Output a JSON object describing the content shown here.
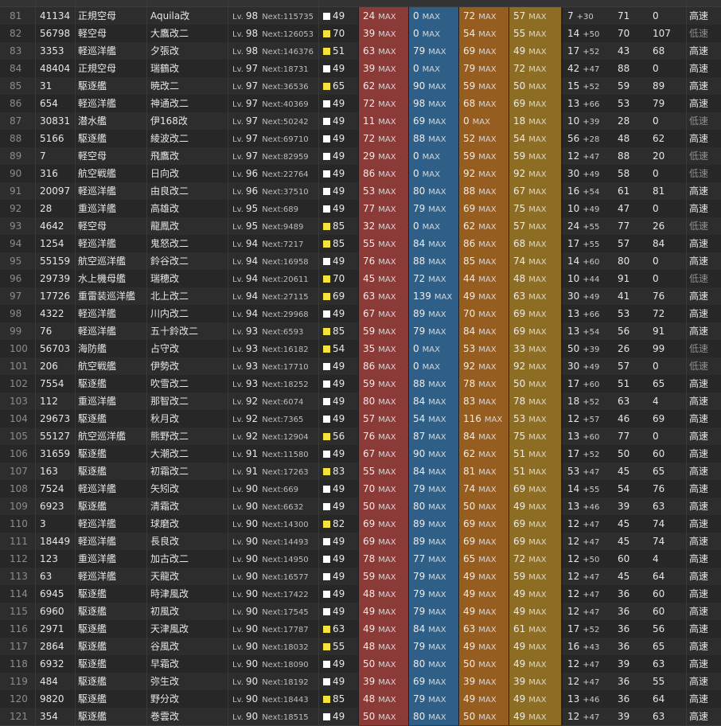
{
  "columns": [
    "no",
    "id",
    "type",
    "name",
    "lv",
    "next",
    "cond",
    "fp",
    "tp",
    "aa",
    "ar",
    "luck",
    "luck_plus",
    "hp",
    "asw",
    "speed"
  ],
  "max_label": "MAX",
  "lv_prefix": "Lv.",
  "next_prefix": "Next:",
  "colors": {
    "cond_white": "#ffffff",
    "cond_yellow": "#f4e33a",
    "fp": "#8a3a37",
    "tp": "#2f5f86",
    "aa": "#955d20",
    "ar": "#8d6d23"
  },
  "rows": [
    {
      "no": "81",
      "id": "41134",
      "type": "正規空母",
      "name": "Aquila改",
      "lv": "98",
      "next": "115735",
      "cond_color": "white",
      "cond": "49",
      "fp": "24",
      "tp": "0",
      "aa": "72",
      "ar": "57",
      "luck": "7",
      "luck_plus": "+30",
      "hp": "71",
      "asw": "0",
      "speed": "高速"
    },
    {
      "no": "82",
      "id": "56798",
      "type": "軽空母",
      "name": "大鷹改二",
      "lv": "98",
      "next": "126053",
      "cond_color": "yellow",
      "cond": "70",
      "fp": "39",
      "tp": "0",
      "aa": "54",
      "ar": "55",
      "luck": "14",
      "luck_plus": "+50",
      "hp": "70",
      "asw": "107",
      "speed": "低速"
    },
    {
      "no": "83",
      "id": "3353",
      "type": "軽巡洋艦",
      "name": "夕張改",
      "lv": "98",
      "next": "146376",
      "cond_color": "yellow",
      "cond": "51",
      "fp": "63",
      "tp": "79",
      "aa": "69",
      "ar": "49",
      "luck": "17",
      "luck_plus": "+52",
      "hp": "43",
      "asw": "68",
      "speed": "高速"
    },
    {
      "no": "84",
      "id": "48404",
      "type": "正規空母",
      "name": "瑞鶴改",
      "lv": "97",
      "next": "18731",
      "cond_color": "white",
      "cond": "49",
      "fp": "39",
      "tp": "0",
      "aa": "79",
      "ar": "72",
      "luck": "42",
      "luck_plus": "+47",
      "hp": "88",
      "asw": "0",
      "speed": "高速"
    },
    {
      "no": "85",
      "id": "31",
      "type": "駆逐艦",
      "name": "暁改二",
      "lv": "97",
      "next": "36536",
      "cond_color": "yellow",
      "cond": "65",
      "fp": "62",
      "tp": "90",
      "aa": "59",
      "ar": "50",
      "luck": "15",
      "luck_plus": "+52",
      "hp": "59",
      "asw": "89",
      "speed": "高速"
    },
    {
      "no": "86",
      "id": "654",
      "type": "軽巡洋艦",
      "name": "神通改二",
      "lv": "97",
      "next": "40369",
      "cond_color": "white",
      "cond": "49",
      "fp": "72",
      "tp": "98",
      "aa": "68",
      "ar": "69",
      "luck": "13",
      "luck_plus": "+66",
      "hp": "53",
      "asw": "79",
      "speed": "高速"
    },
    {
      "no": "87",
      "id": "30831",
      "type": "潜水艦",
      "name": "伊168改",
      "lv": "97",
      "next": "50242",
      "cond_color": "white",
      "cond": "49",
      "fp": "11",
      "tp": "69",
      "aa": "0",
      "ar": "18",
      "luck": "10",
      "luck_plus": "+39",
      "hp": "28",
      "asw": "0",
      "speed": "低速"
    },
    {
      "no": "88",
      "id": "5166",
      "type": "駆逐艦",
      "name": "綾波改二",
      "lv": "97",
      "next": "69710",
      "cond_color": "white",
      "cond": "49",
      "fp": "72",
      "tp": "88",
      "aa": "52",
      "ar": "54",
      "luck": "56",
      "luck_plus": "+28",
      "hp": "48",
      "asw": "62",
      "speed": "高速"
    },
    {
      "no": "89",
      "id": "7",
      "type": "軽空母",
      "name": "飛鷹改",
      "lv": "97",
      "next": "82959",
      "cond_color": "white",
      "cond": "49",
      "fp": "29",
      "tp": "0",
      "aa": "59",
      "ar": "59",
      "luck": "12",
      "luck_plus": "+47",
      "hp": "88",
      "asw": "20",
      "speed": "低速"
    },
    {
      "no": "90",
      "id": "316",
      "type": "航空戦艦",
      "name": "日向改",
      "lv": "96",
      "next": "22764",
      "cond_color": "white",
      "cond": "49",
      "fp": "86",
      "tp": "0",
      "aa": "92",
      "ar": "92",
      "luck": "30",
      "luck_plus": "+49",
      "hp": "58",
      "asw": "0",
      "speed": "低速"
    },
    {
      "no": "91",
      "id": "20097",
      "type": "軽巡洋艦",
      "name": "由良改二",
      "lv": "96",
      "next": "37510",
      "cond_color": "white",
      "cond": "49",
      "fp": "53",
      "tp": "80",
      "aa": "88",
      "ar": "67",
      "luck": "16",
      "luck_plus": "+54",
      "hp": "61",
      "asw": "81",
      "speed": "高速"
    },
    {
      "no": "92",
      "id": "28",
      "type": "重巡洋艦",
      "name": "高雄改",
      "lv": "95",
      "next": "689",
      "cond_color": "white",
      "cond": "49",
      "fp": "77",
      "tp": "79",
      "aa": "69",
      "ar": "75",
      "luck": "10",
      "luck_plus": "+49",
      "hp": "47",
      "asw": "0",
      "speed": "高速"
    },
    {
      "no": "93",
      "id": "4642",
      "type": "軽空母",
      "name": "龍鳳改",
      "lv": "95",
      "next": "9489",
      "cond_color": "yellow",
      "cond": "85",
      "fp": "32",
      "tp": "0",
      "aa": "62",
      "ar": "57",
      "luck": "24",
      "luck_plus": "+55",
      "hp": "77",
      "asw": "26",
      "speed": "低速"
    },
    {
      "no": "94",
      "id": "1254",
      "type": "軽巡洋艦",
      "name": "鬼怒改二",
      "lv": "94",
      "next": "7217",
      "cond_color": "yellow",
      "cond": "85",
      "fp": "55",
      "tp": "84",
      "aa": "86",
      "ar": "68",
      "luck": "17",
      "luck_plus": "+55",
      "hp": "57",
      "asw": "84",
      "speed": "高速"
    },
    {
      "no": "95",
      "id": "55159",
      "type": "航空巡洋艦",
      "name": "鈴谷改二",
      "lv": "94",
      "next": "16958",
      "cond_color": "white",
      "cond": "49",
      "fp": "76",
      "tp": "88",
      "aa": "85",
      "ar": "74",
      "luck": "14",
      "luck_plus": "+60",
      "hp": "80",
      "asw": "0",
      "speed": "高速"
    },
    {
      "no": "96",
      "id": "29739",
      "type": "水上機母艦",
      "name": "瑞穂改",
      "lv": "94",
      "next": "20611",
      "cond_color": "yellow",
      "cond": "70",
      "fp": "45",
      "tp": "72",
      "aa": "44",
      "ar": "48",
      "luck": "10",
      "luck_plus": "+44",
      "hp": "91",
      "asw": "0",
      "speed": "低速"
    },
    {
      "no": "97",
      "id": "17726",
      "type": "重雷装巡洋艦",
      "name": "北上改二",
      "lv": "94",
      "next": "27115",
      "cond_color": "yellow",
      "cond": "69",
      "fp": "63",
      "tp": "139",
      "aa": "49",
      "ar": "63",
      "luck": "30",
      "luck_plus": "+49",
      "hp": "41",
      "asw": "76",
      "speed": "高速"
    },
    {
      "no": "98",
      "id": "4322",
      "type": "軽巡洋艦",
      "name": "川内改二",
      "lv": "94",
      "next": "29968",
      "cond_color": "white",
      "cond": "49",
      "fp": "67",
      "tp": "89",
      "aa": "70",
      "ar": "69",
      "luck": "13",
      "luck_plus": "+66",
      "hp": "53",
      "asw": "72",
      "speed": "高速"
    },
    {
      "no": "99",
      "id": "76",
      "type": "軽巡洋艦",
      "name": "五十鈴改二",
      "lv": "93",
      "next": "6593",
      "cond_color": "yellow",
      "cond": "85",
      "fp": "59",
      "tp": "79",
      "aa": "84",
      "ar": "69",
      "luck": "13",
      "luck_plus": "+54",
      "hp": "56",
      "asw": "91",
      "speed": "高速"
    },
    {
      "no": "100",
      "id": "56703",
      "type": "海防艦",
      "name": "占守改",
      "lv": "93",
      "next": "16182",
      "cond_color": "yellow",
      "cond": "54",
      "fp": "35",
      "tp": "0",
      "aa": "53",
      "ar": "33",
      "luck": "50",
      "luck_plus": "+39",
      "hp": "26",
      "asw": "99",
      "speed": "低速"
    },
    {
      "no": "101",
      "id": "206",
      "type": "航空戦艦",
      "name": "伊勢改",
      "lv": "93",
      "next": "17710",
      "cond_color": "white",
      "cond": "49",
      "fp": "86",
      "tp": "0",
      "aa": "92",
      "ar": "92",
      "luck": "30",
      "luck_plus": "+49",
      "hp": "57",
      "asw": "0",
      "speed": "低速"
    },
    {
      "no": "102",
      "id": "7554",
      "type": "駆逐艦",
      "name": "吹雪改二",
      "lv": "93",
      "next": "18252",
      "cond_color": "white",
      "cond": "49",
      "fp": "59",
      "tp": "88",
      "aa": "78",
      "ar": "50",
      "luck": "17",
      "luck_plus": "+60",
      "hp": "51",
      "asw": "65",
      "speed": "高速"
    },
    {
      "no": "103",
      "id": "112",
      "type": "重巡洋艦",
      "name": "那智改二",
      "lv": "92",
      "next": "6074",
      "cond_color": "white",
      "cond": "49",
      "fp": "80",
      "tp": "84",
      "aa": "83",
      "ar": "78",
      "luck": "18",
      "luck_plus": "+52",
      "hp": "63",
      "asw": "4",
      "speed": "高速"
    },
    {
      "no": "104",
      "id": "29673",
      "type": "駆逐艦",
      "name": "秋月改",
      "lv": "92",
      "next": "7365",
      "cond_color": "white",
      "cond": "49",
      "fp": "57",
      "tp": "54",
      "aa": "116",
      "ar": "53",
      "luck": "12",
      "luck_plus": "+57",
      "hp": "46",
      "asw": "69",
      "speed": "高速"
    },
    {
      "no": "105",
      "id": "55127",
      "type": "航空巡洋艦",
      "name": "熊野改二",
      "lv": "92",
      "next": "12904",
      "cond_color": "yellow",
      "cond": "56",
      "fp": "76",
      "tp": "87",
      "aa": "84",
      "ar": "75",
      "luck": "13",
      "luck_plus": "+60",
      "hp": "77",
      "asw": "0",
      "speed": "高速"
    },
    {
      "no": "106",
      "id": "31659",
      "type": "駆逐艦",
      "name": "大潮改二",
      "lv": "91",
      "next": "11580",
      "cond_color": "white",
      "cond": "49",
      "fp": "67",
      "tp": "90",
      "aa": "62",
      "ar": "51",
      "luck": "17",
      "luck_plus": "+52",
      "hp": "50",
      "asw": "60",
      "speed": "高速"
    },
    {
      "no": "107",
      "id": "163",
      "type": "駆逐艦",
      "name": "初霜改二",
      "lv": "91",
      "next": "17263",
      "cond_color": "yellow",
      "cond": "83",
      "fp": "55",
      "tp": "84",
      "aa": "81",
      "ar": "51",
      "luck": "53",
      "luck_plus": "+47",
      "hp": "45",
      "asw": "65",
      "speed": "高速"
    },
    {
      "no": "108",
      "id": "7524",
      "type": "軽巡洋艦",
      "name": "矢矧改",
      "lv": "90",
      "next": "669",
      "cond_color": "white",
      "cond": "49",
      "fp": "70",
      "tp": "79",
      "aa": "74",
      "ar": "69",
      "luck": "14",
      "luck_plus": "+55",
      "hp": "54",
      "asw": "76",
      "speed": "高速"
    },
    {
      "no": "109",
      "id": "6923",
      "type": "駆逐艦",
      "name": "清霜改",
      "lv": "90",
      "next": "6632",
      "cond_color": "white",
      "cond": "49",
      "fp": "50",
      "tp": "80",
      "aa": "50",
      "ar": "49",
      "luck": "13",
      "luck_plus": "+46",
      "hp": "39",
      "asw": "63",
      "speed": "高速"
    },
    {
      "no": "110",
      "id": "3",
      "type": "軽巡洋艦",
      "name": "球磨改",
      "lv": "90",
      "next": "14300",
      "cond_color": "yellow",
      "cond": "82",
      "fp": "69",
      "tp": "89",
      "aa": "69",
      "ar": "69",
      "luck": "12",
      "luck_plus": "+47",
      "hp": "45",
      "asw": "74",
      "speed": "高速"
    },
    {
      "no": "111",
      "id": "18449",
      "type": "軽巡洋艦",
      "name": "長良改",
      "lv": "90",
      "next": "14493",
      "cond_color": "white",
      "cond": "49",
      "fp": "69",
      "tp": "89",
      "aa": "69",
      "ar": "69",
      "luck": "12",
      "luck_plus": "+47",
      "hp": "45",
      "asw": "74",
      "speed": "高速"
    },
    {
      "no": "112",
      "id": "123",
      "type": "重巡洋艦",
      "name": "加古改二",
      "lv": "90",
      "next": "14950",
      "cond_color": "white",
      "cond": "49",
      "fp": "78",
      "tp": "77",
      "aa": "65",
      "ar": "72",
      "luck": "12",
      "luck_plus": "+50",
      "hp": "60",
      "asw": "4",
      "speed": "高速"
    },
    {
      "no": "113",
      "id": "63",
      "type": "軽巡洋艦",
      "name": "天龍改",
      "lv": "90",
      "next": "16577",
      "cond_color": "white",
      "cond": "49",
      "fp": "59",
      "tp": "79",
      "aa": "49",
      "ar": "59",
      "luck": "12",
      "luck_plus": "+47",
      "hp": "45",
      "asw": "64",
      "speed": "高速"
    },
    {
      "no": "114",
      "id": "6945",
      "type": "駆逐艦",
      "name": "時津風改",
      "lv": "90",
      "next": "17422",
      "cond_color": "white",
      "cond": "49",
      "fp": "48",
      "tp": "79",
      "aa": "49",
      "ar": "49",
      "luck": "12",
      "luck_plus": "+47",
      "hp": "36",
      "asw": "60",
      "speed": "高速"
    },
    {
      "no": "115",
      "id": "6960",
      "type": "駆逐艦",
      "name": "初風改",
      "lv": "90",
      "next": "17545",
      "cond_color": "white",
      "cond": "49",
      "fp": "49",
      "tp": "79",
      "aa": "49",
      "ar": "49",
      "luck": "12",
      "luck_plus": "+47",
      "hp": "36",
      "asw": "60",
      "speed": "高速"
    },
    {
      "no": "116",
      "id": "2971",
      "type": "駆逐艦",
      "name": "天津風改",
      "lv": "90",
      "next": "17787",
      "cond_color": "yellow",
      "cond": "63",
      "fp": "49",
      "tp": "84",
      "aa": "63",
      "ar": "61",
      "luck": "17",
      "luck_plus": "+52",
      "hp": "36",
      "asw": "56",
      "speed": "高速"
    },
    {
      "no": "117",
      "id": "2864",
      "type": "駆逐艦",
      "name": "谷風改",
      "lv": "90",
      "next": "18032",
      "cond_color": "yellow",
      "cond": "55",
      "fp": "48",
      "tp": "79",
      "aa": "49",
      "ar": "49",
      "luck": "16",
      "luck_plus": "+43",
      "hp": "36",
      "asw": "65",
      "speed": "高速"
    },
    {
      "no": "118",
      "id": "6932",
      "type": "駆逐艦",
      "name": "早霜改",
      "lv": "90",
      "next": "18090",
      "cond_color": "white",
      "cond": "49",
      "fp": "50",
      "tp": "80",
      "aa": "50",
      "ar": "49",
      "luck": "12",
      "luck_plus": "+47",
      "hp": "39",
      "asw": "63",
      "speed": "高速"
    },
    {
      "no": "119",
      "id": "484",
      "type": "駆逐艦",
      "name": "弥生改",
      "lv": "90",
      "next": "18192",
      "cond_color": "white",
      "cond": "49",
      "fp": "39",
      "tp": "69",
      "aa": "39",
      "ar": "39",
      "luck": "12",
      "luck_plus": "+47",
      "hp": "36",
      "asw": "55",
      "speed": "高速"
    },
    {
      "no": "120",
      "id": "9820",
      "type": "駆逐艦",
      "name": "野分改",
      "lv": "90",
      "next": "18443",
      "cond_color": "yellow",
      "cond": "85",
      "fp": "48",
      "tp": "79",
      "aa": "49",
      "ar": "49",
      "luck": "13",
      "luck_plus": "+46",
      "hp": "36",
      "asw": "64",
      "speed": "高速"
    },
    {
      "no": "121",
      "id": "354",
      "type": "駆逐艦",
      "name": "巻雲改",
      "lv": "90",
      "next": "18515",
      "cond_color": "white",
      "cond": "49",
      "fp": "50",
      "tp": "80",
      "aa": "50",
      "ar": "49",
      "luck": "12",
      "luck_plus": "+47",
      "hp": "39",
      "asw": "63",
      "speed": "高速"
    }
  ]
}
